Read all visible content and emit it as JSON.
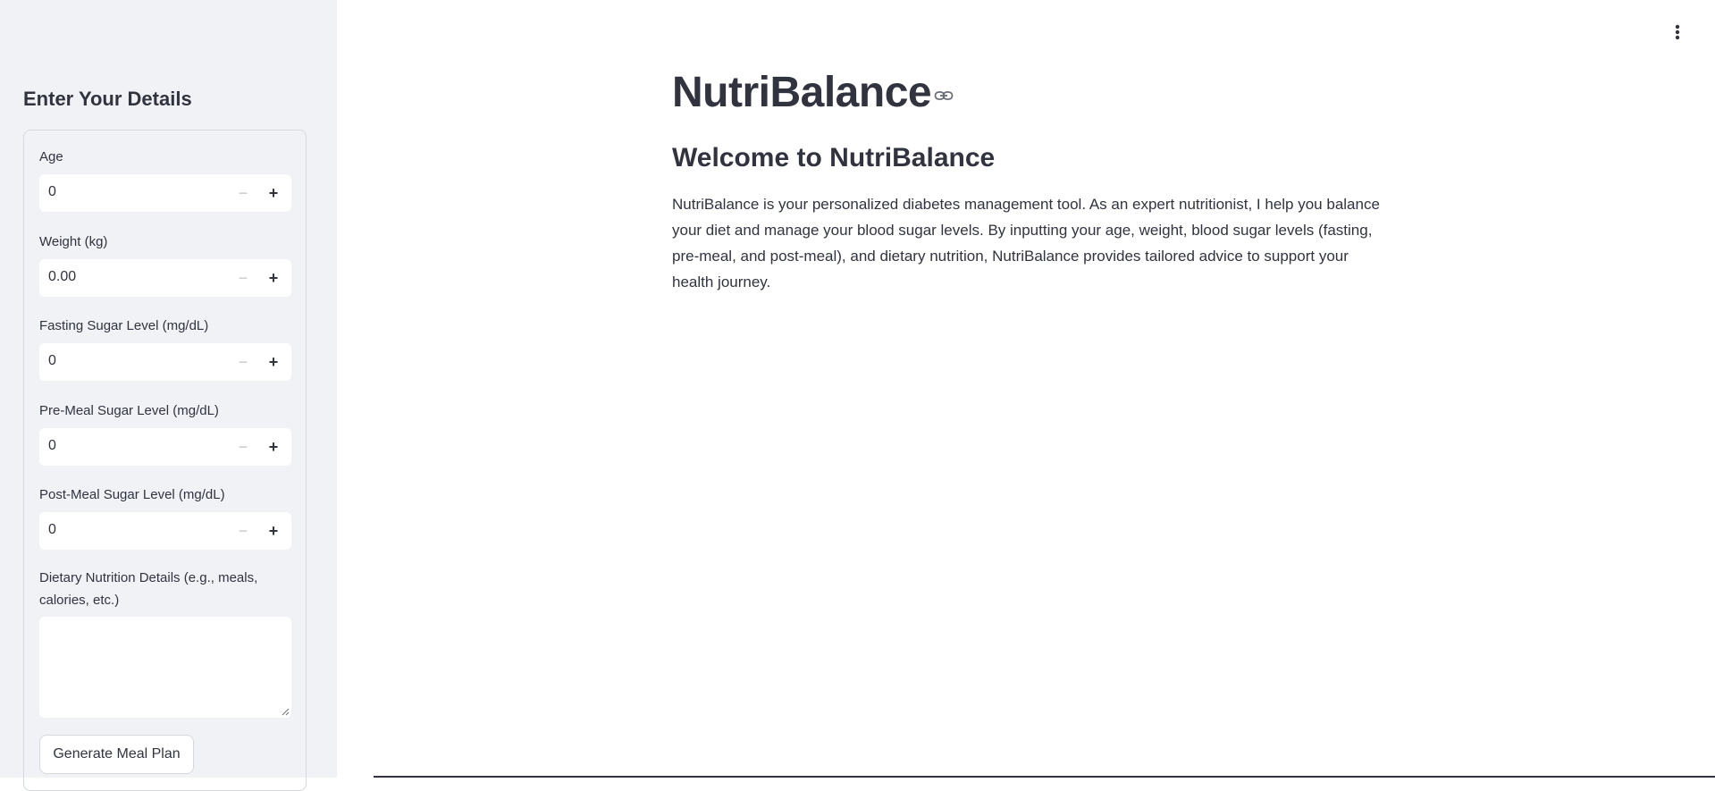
{
  "sidebar": {
    "title": "Enter Your Details",
    "fields": [
      {
        "label": "Age",
        "value": "0"
      },
      {
        "label": "Weight (kg)",
        "value": "0.00"
      },
      {
        "label": "Fasting Sugar Level (mg/dL)",
        "value": "0"
      },
      {
        "label": "Pre-Meal Sugar Level (mg/dL)",
        "value": "0"
      },
      {
        "label": "Post-Meal Sugar Level (mg/dL)",
        "value": "0"
      }
    ],
    "stepper_minus": "−",
    "stepper_plus": "+",
    "dietary_label_line1": "Dietary Nutrition Details (e.g., meals,",
    "dietary_label_line2": "calories, etc.)",
    "dietary_value": "",
    "generate_button": "Generate Meal Plan"
  },
  "main": {
    "title": "NutriBalance",
    "subtitle": "Welcome to NutriBalance",
    "description": "NutriBalance is your personalized diabetes management tool. As an expert nutritionist, I help you balance your diet and manage your blood sugar levels. By inputting your age, weight, blood sugar levels (fasting, pre-meal, and post-meal), and dietary nutrition, NutriBalance provides tailored advice to support your health journey."
  },
  "icons": {
    "menu": "kebab-menu-icon",
    "link": "link-icon"
  }
}
